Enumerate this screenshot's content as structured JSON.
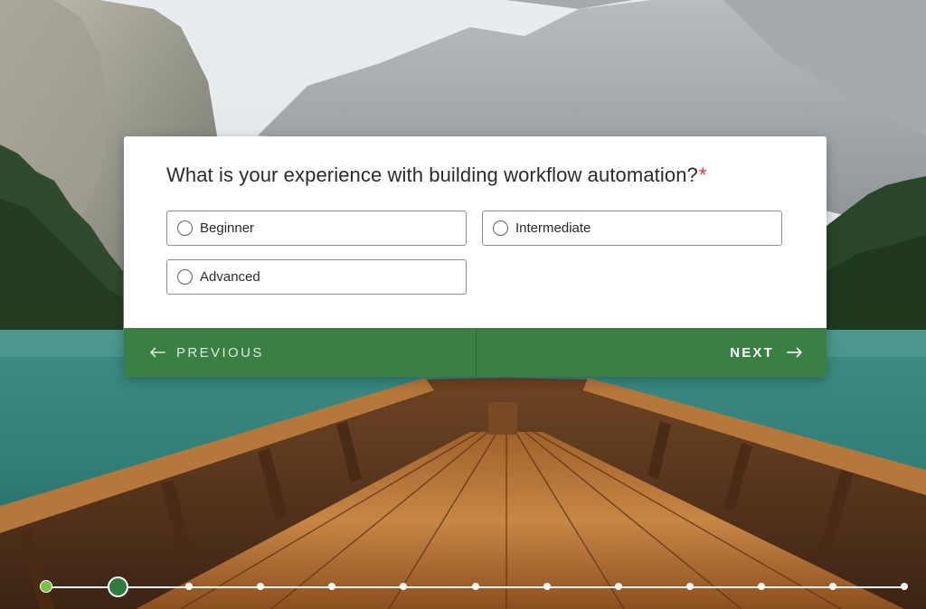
{
  "question": {
    "text": "What is your experience with building workflow automation?",
    "required_marker": "*"
  },
  "options": [
    {
      "label": "Beginner",
      "selected": false
    },
    {
      "label": "Intermediate",
      "selected": false
    },
    {
      "label": "Advanced",
      "selected": false
    }
  ],
  "navigation": {
    "previous_label": "PREVIOUS",
    "next_label": "NEXT"
  },
  "progress": {
    "total_steps": 13,
    "current_step": 2
  },
  "colors": {
    "accent": "#3a8045",
    "required": "#e03131",
    "progress_done": "#7cc242",
    "progress_current": "#2f7a3e"
  },
  "icons": {
    "previous": "arrow-left-icon",
    "next": "arrow-right-icon"
  }
}
